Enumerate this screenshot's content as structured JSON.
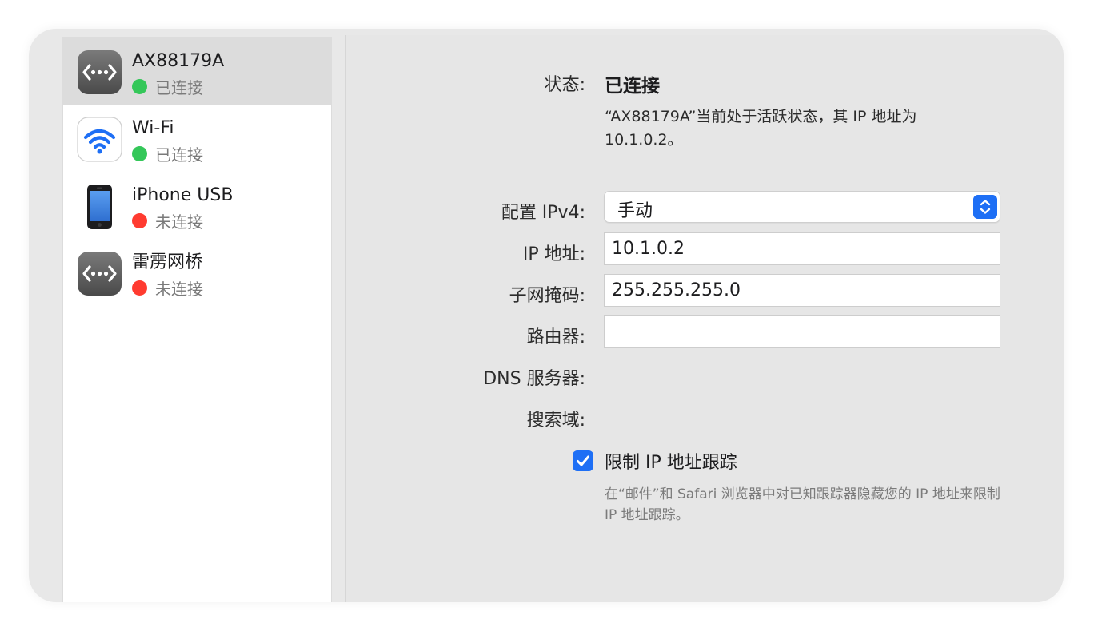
{
  "services": [
    {
      "name": "AX88179A",
      "status": "已连接",
      "status_color": "#34c759",
      "icon": "ethernet-icon",
      "selected": true
    },
    {
      "name": "Wi-Fi",
      "status": "已连接",
      "status_color": "#34c759",
      "icon": "wifi-icon",
      "selected": false
    },
    {
      "name": "iPhone USB",
      "status": "未连接",
      "status_color": "#ff3b30",
      "icon": "iphone-icon",
      "selected": false
    },
    {
      "name": "雷雳网桥",
      "status": "未连接",
      "status_color": "#ff3b30",
      "icon": "ethernet-icon",
      "selected": false
    }
  ],
  "detail": {
    "status_label": "状态:",
    "status_value": "已连接",
    "status_description": "“AX88179A”当前处于活跃状态，其 IP 地址为 10.1.0.2。",
    "configure_label": "配置 IPv4:",
    "configure_value": "手动",
    "ip_label": "IP 地址:",
    "ip_value": "10.1.0.2",
    "subnet_label": "子网掩码:",
    "subnet_value": "255.255.255.0",
    "router_label": "路由器:",
    "router_value": "",
    "dns_label": "DNS 服务器:",
    "search_label": "搜索域:",
    "limit_tracking_label": "限制 IP 地址跟踪",
    "limit_tracking_checked": true,
    "limit_tracking_description": "在“邮件”和 Safari 浏览器中对已知跟踪器隐藏您的 IP 地址来限制 IP 地址跟踪。"
  },
  "colors": {
    "accent": "#1e6ff5",
    "connected": "#34c759",
    "disconnected": "#ff3b30"
  }
}
